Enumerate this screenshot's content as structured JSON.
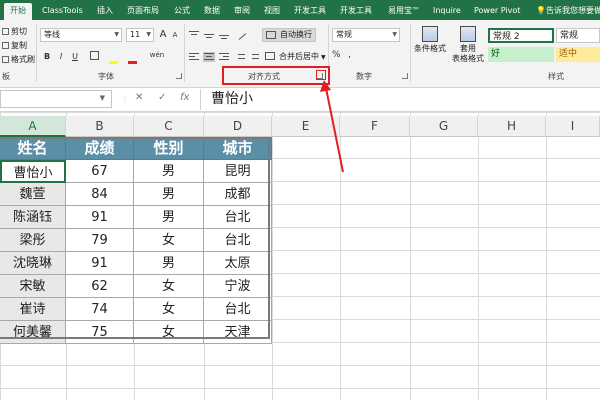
{
  "ribbon_tabs": [
    "开始",
    "ClassTools",
    "插入",
    "页面布局",
    "公式",
    "数据",
    "审阅",
    "视图",
    "开发工具",
    "开发工具",
    "易用宝™",
    "Inquire",
    "Power Pivot"
  ],
  "tell_me": "告诉我您想要做",
  "clipboard": {
    "cut": "剪切",
    "copy": "复制",
    "format_painter": "格式刷",
    "group_label": "板"
  },
  "font": {
    "name": "等线",
    "size": "11",
    "grow": "A",
    "shrink": "A",
    "bold": "B",
    "italic": "I",
    "underline": "U",
    "wen": "wén",
    "group_label": "字体"
  },
  "alignment": {
    "wrap_text": "自动换行",
    "merge_center": "合并后居中",
    "group_label": "对齐方式"
  },
  "number": {
    "format": "常规",
    "percent": "%",
    "comma": ",",
    "group_label": "数字"
  },
  "styles": {
    "conditional": "条件格式",
    "table": "套用\n表格格式",
    "normal2": "常规 2",
    "normal": "常规",
    "good": "好",
    "neutral": "适中",
    "group_label": "样式"
  },
  "formula_bar": {
    "cancel": "✕",
    "enter": "✓",
    "fx": "fx",
    "content": "曹怡小"
  },
  "columns": [
    "A",
    "B",
    "C",
    "D",
    "E",
    "F",
    "G",
    "H",
    "I"
  ],
  "table": {
    "headers": [
      "姓名",
      "成绩",
      "性别",
      "城市"
    ],
    "rows": [
      [
        "曹怡小",
        "67",
        "男",
        "昆明"
      ],
      [
        "魏萱",
        "84",
        "男",
        "成都"
      ],
      [
        "陈涵钰",
        "91",
        "男",
        "台北"
      ],
      [
        "梁彤",
        "79",
        "女",
        "台北"
      ],
      [
        "沈晓琳",
        "91",
        "男",
        "太原"
      ],
      [
        "宋敏",
        "62",
        "女",
        "宁波"
      ],
      [
        "崔诗",
        "74",
        "女",
        "台北"
      ],
      [
        "何美馨",
        "75",
        "女",
        "天津"
      ]
    ]
  },
  "colors": {
    "excel_green": "#217346",
    "header_fill": "#5b8fa8",
    "highlight_red": "#e02020"
  }
}
